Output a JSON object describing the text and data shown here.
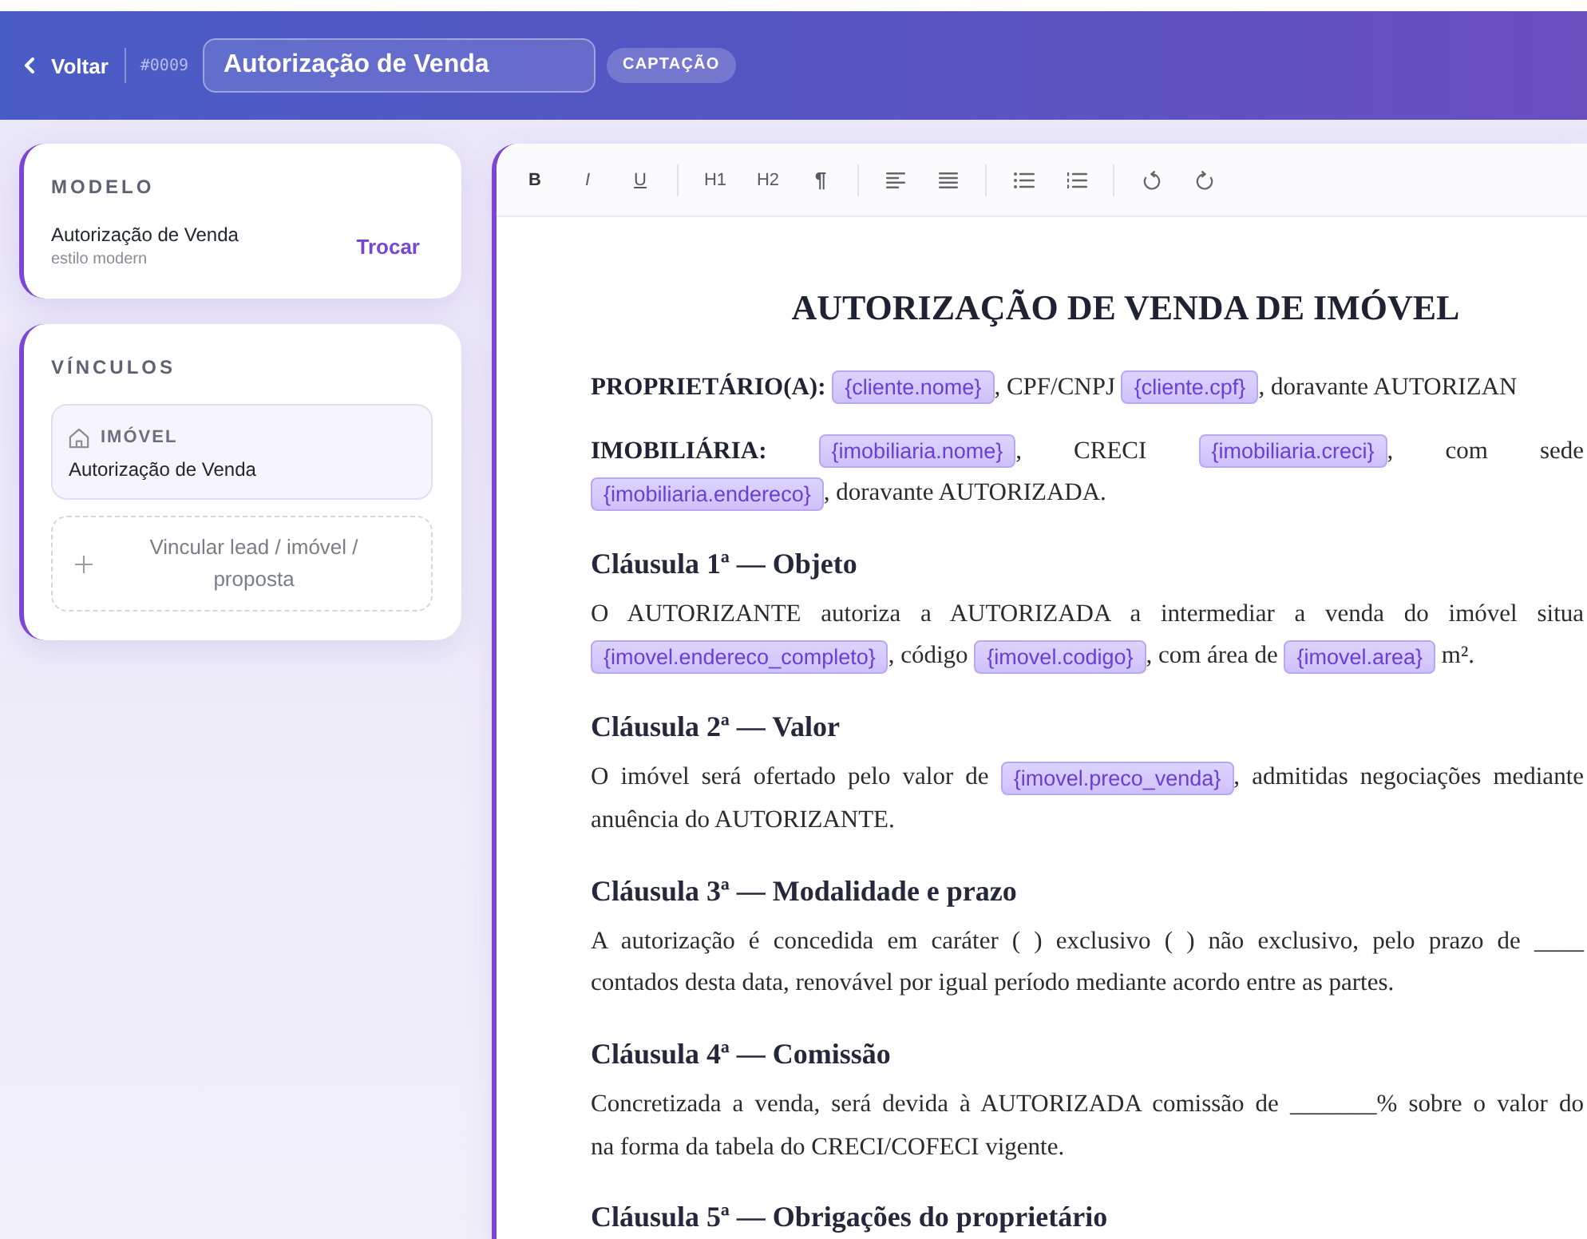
{
  "header": {
    "back_label": "Voltar",
    "doc_number": "#0009",
    "title_field": {
      "value": "Autorização de Venda"
    },
    "badge": "CAPTAÇÃO"
  },
  "sidebar": {
    "model_card": {
      "heading": "MODELO",
      "name": "Autorização de Venda",
      "style": "estilo modern",
      "action": "Trocar"
    },
    "links_card": {
      "heading": "VÍNCULOS",
      "links": [
        {
          "kind": "property",
          "type_label": "IMÓVEL",
          "title": "Autorização de Venda"
        }
      ],
      "add_action": "Vincular lead / imóvel / proposta"
    }
  },
  "editor": {
    "toolbar": {
      "groups": [
        [
          {
            "kind": "bold",
            "label": "B"
          },
          {
            "kind": "italic",
            "label": "I"
          },
          {
            "kind": "underline",
            "label": "U"
          }
        ],
        [
          {
            "kind": "heading",
            "label": "H1"
          },
          {
            "kind": "heading",
            "label": "H2"
          },
          {
            "kind": "paragraph",
            "label": "¶"
          }
        ],
        [
          {
            "kind": "align-left"
          },
          {
            "kind": "justify"
          }
        ],
        [
          {
            "kind": "bullet-list"
          },
          {
            "kind": "numbered-list"
          }
        ],
        [
          {
            "kind": "undo"
          },
          {
            "kind": "redo"
          }
        ]
      ]
    },
    "document": {
      "title": "AUTORIZAÇÃO DE VENDA DE IMÓVEL",
      "blocks": [
        {
          "kind": "paragraph",
          "lines": [
            [
              {
                "kind": "label",
                "text": "PROPRIETÁRIO(A): "
              },
              {
                "kind": "variable",
                "text": "{cliente.nome}"
              },
              {
                "kind": "text",
                "text": ", CPF/CNPJ "
              },
              {
                "kind": "variable",
                "text": "{cliente.cpf}"
              },
              {
                "kind": "text",
                "text": ", doravante AUTORIZAN"
              }
            ]
          ]
        },
        {
          "kind": "paragraph",
          "lines": [
            [
              {
                "kind": "label",
                "text": "IMOBILIÁRIA: "
              },
              {
                "kind": "variable",
                "text": "{imobiliaria.nome}"
              },
              {
                "kind": "text",
                "text": ", CRECI "
              },
              {
                "kind": "variable",
                "text": "{imobiliaria.creci}"
              },
              {
                "kind": "text",
                "text": ", com sede"
              }
            ],
            [
              {
                "kind": "variable",
                "text": "{imobiliaria.endereco}"
              },
              {
                "kind": "text",
                "text": ", doravante AUTORIZADA."
              }
            ]
          ]
        },
        {
          "kind": "heading",
          "text": "Cláusula 1ª — Objeto"
        },
        {
          "kind": "paragraph",
          "lines": [
            [
              {
                "kind": "text",
                "text": "O AUTORIZANTE autoriza a AUTORIZADA a intermediar a venda do imóvel situa"
              }
            ],
            [
              {
                "kind": "variable",
                "text": "{imovel.endereco_completo}"
              },
              {
                "kind": "text",
                "text": ", código "
              },
              {
                "kind": "variable",
                "text": "{imovel.codigo}"
              },
              {
                "kind": "text",
                "text": ", com área de "
              },
              {
                "kind": "variable",
                "text": "{imovel.area}"
              },
              {
                "kind": "text",
                "text": " m²."
              }
            ]
          ]
        },
        {
          "kind": "heading",
          "text": "Cláusula 2ª — Valor"
        },
        {
          "kind": "paragraph",
          "lines": [
            [
              {
                "kind": "text",
                "text": "O imóvel será ofertado pelo valor de "
              },
              {
                "kind": "variable",
                "text": "{imovel.preco_venda}"
              },
              {
                "kind": "text",
                "text": ", admitidas negociações mediante"
              }
            ],
            [
              {
                "kind": "text",
                "text": "anuência do AUTORIZANTE."
              }
            ]
          ]
        },
        {
          "kind": "heading",
          "text": "Cláusula 3ª — Modalidade e prazo"
        },
        {
          "kind": "paragraph",
          "lines": [
            [
              {
                "kind": "text",
                "text": "A autorização é concedida em caráter ( ) exclusivo ( ) não exclusivo, pelo prazo de ____"
              }
            ],
            [
              {
                "kind": "text",
                "text": "contados desta data, renovável por igual período mediante acordo entre as partes."
              }
            ]
          ]
        },
        {
          "kind": "heading",
          "text": "Cláusula 4ª — Comissão"
        },
        {
          "kind": "paragraph",
          "lines": [
            [
              {
                "kind": "text",
                "text": "Concretizada a venda, será devida à AUTORIZADA comissão de _______% sobre o valor do"
              }
            ],
            [
              {
                "kind": "text",
                "text": "na forma da tabela do CRECI/COFECI vigente."
              }
            ]
          ]
        },
        {
          "kind": "heading",
          "text": "Cláusula 5ª — Obrigações do proprietário"
        }
      ]
    }
  }
}
